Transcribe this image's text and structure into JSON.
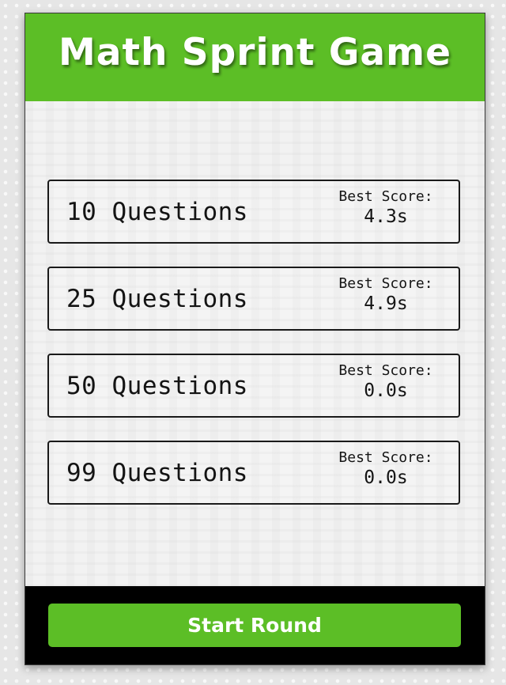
{
  "header": {
    "title": "Math Sprint Game"
  },
  "questions": {
    "options": [
      {
        "label": "10 Questions",
        "best_score_label": "Best Score:",
        "best_score_value": "4.3s"
      },
      {
        "label": "25 Questions",
        "best_score_label": "Best Score:",
        "best_score_value": "4.9s"
      },
      {
        "label": "50 Questions",
        "best_score_label": "Best Score:",
        "best_score_value": "0.0s"
      },
      {
        "label": "99 Questions",
        "best_score_label": "Best Score:",
        "best_score_value": "0.0s"
      }
    ]
  },
  "footer": {
    "start_label": "Start Round"
  },
  "colors": {
    "accent_green": "#5cbe26",
    "footer_black": "#000000",
    "card_background": "#f2f2f2",
    "page_background": "#e6e6e6"
  }
}
